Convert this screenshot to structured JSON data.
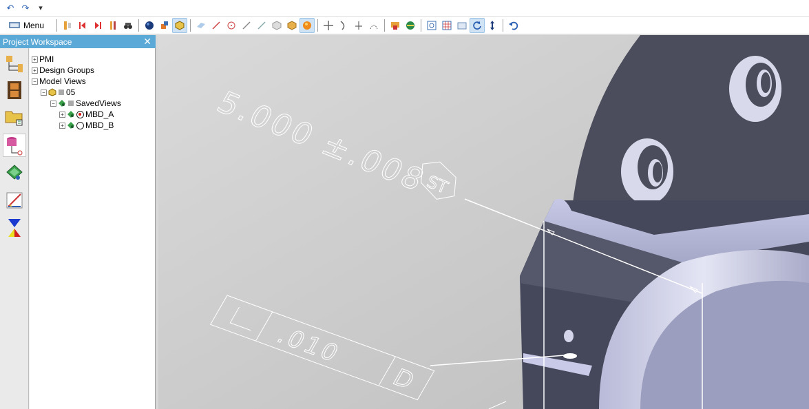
{
  "quick_access": {
    "icons": [
      "undo-icon",
      "redo-icon",
      "customize-dropdown-icon"
    ],
    "undo_glyph": "↶",
    "redo_glyph": "↷",
    "dropdown_glyph": "▾"
  },
  "toolbar": {
    "menu_label": "Menu",
    "icons": [
      "structure-icon",
      "prev-view-icon",
      "next-view-icon",
      "list-icon",
      "binoculars-icon",
      "sphere-icon",
      "exploded-icon",
      "part-box-icon",
      "section-plane-icon",
      "line-icon",
      "circle-icon",
      "line-diagonal-icon",
      "line-angle-icon",
      "shaded-box-icon",
      "solid-box-icon",
      "render-icon",
      "move-icon",
      "bend-icon",
      "axes-icon",
      "curve-icon",
      "color-icon",
      "globe-icon",
      "zoom-fit-icon",
      "grid-icon",
      "window-icon",
      "rotate-icon",
      "updown-icon",
      "undo-view-icon"
    ]
  },
  "panel": {
    "title": "Project Workspace",
    "close_glyph": "✕"
  },
  "side_icons": [
    "assembly-tree-icon",
    "film-icon",
    "folder-tree-icon",
    "database-icon",
    "model-views-icon",
    "drawing-icon",
    "hourglass-icon"
  ],
  "tree": {
    "items": [
      {
        "label": "PMI",
        "expander": "+"
      },
      {
        "label": "Design Groups",
        "expander": "+"
      },
      {
        "label": "Model Views",
        "expander": "−"
      },
      {
        "label": "05",
        "expander": "−"
      },
      {
        "label": "SavedViews",
        "expander": "−"
      },
      {
        "label": "MBD_A",
        "expander": "+",
        "selected": true
      },
      {
        "label": "MBD_B",
        "expander": "+",
        "selected": false
      }
    ]
  },
  "viewport": {
    "dimension_text": "5.000 ±.008",
    "dimension_modifier": "ST",
    "gdt_value": ".010",
    "gdt_datum": "D",
    "colors": {
      "background_light": "#d9d9d9",
      "background_dark": "#bfbfbf",
      "part_dark": "#4a4c5a",
      "part_light": "#c9cbe6",
      "annotation": "#ffffff"
    }
  }
}
